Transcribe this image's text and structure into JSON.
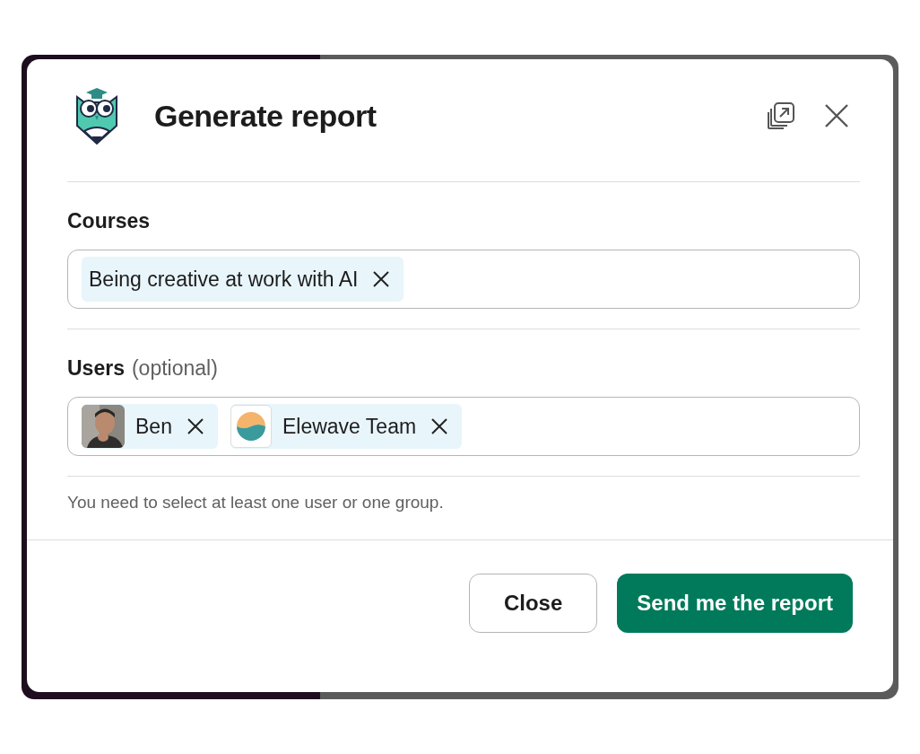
{
  "modal": {
    "title": "Generate report"
  },
  "fields": [
    {
      "label": "Courses",
      "chips": [
        {
          "kind": "text",
          "label": "Being creative at work with AI"
        }
      ]
    },
    {
      "label": "Users",
      "hint": "(optional)",
      "chips": [
        {
          "label": "Ben"
        },
        {
          "kind": "logo",
          "label": "Elewave Team"
        }
      ]
    }
  ],
  "message": "You need to select at least one user or one group.",
  "buttons": [
    {
      "kind": "secondary",
      "label": "Close"
    },
    {
      "kind": "primary",
      "label": "Send me the report"
    }
  ]
}
